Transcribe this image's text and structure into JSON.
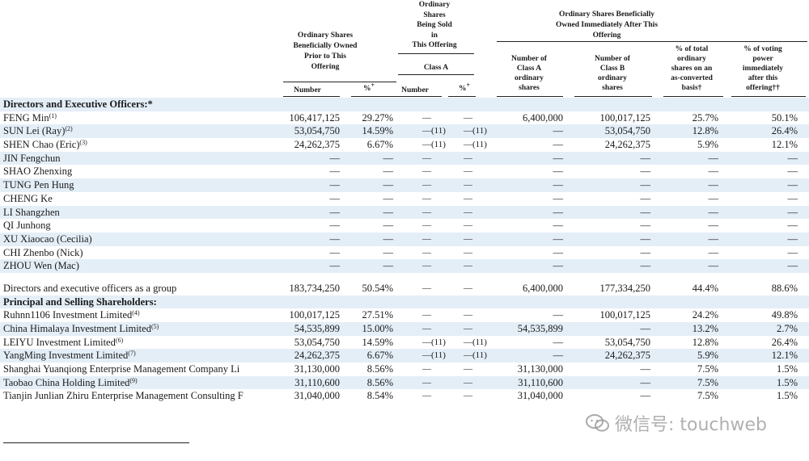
{
  "headers": {
    "group_prior": [
      "Ordinary Shares",
      "Beneficially Owned",
      "Prior to This",
      "Offering"
    ],
    "group_sold": [
      "Ordinary",
      "Shares",
      "Being Sold",
      "in",
      "This Offering"
    ],
    "group_after": [
      "Ordinary Shares Beneficially",
      "Owned Immediately After This",
      "Offering"
    ],
    "class_a": "Class A",
    "sub_number": "Number",
    "sub_pct": "%",
    "sub_pct_mark": "+",
    "sub_sold_number": "Number",
    "sub_sold_pct": "%",
    "sub_num_class_a": [
      "Number of",
      "Class A",
      "ordinary",
      "shares"
    ],
    "sub_num_class_b": [
      "Number of",
      "Class B",
      "ordinary",
      "shares"
    ],
    "sub_pct_total": [
      "% of total",
      "ordinary",
      "shares on an",
      "as-converted",
      "basis†"
    ],
    "sub_pct_voting": [
      "% of voting",
      "power",
      "immediately",
      "after this",
      "offering††"
    ]
  },
  "rows": [
    {
      "type": "section",
      "name": "Directors and Executive Officers:*"
    },
    {
      "name": "FENG Min",
      "note": "(1)",
      "num": "106,417,125",
      "pct": "29.27%",
      "sold_num": "—",
      "sold_pct": "—",
      "class_a": "6,400,000",
      "class_b": "100,017,125",
      "pct_total": "25.7%",
      "pct_voting": "50.1%"
    },
    {
      "name": "SUN Lei (Ray)",
      "note": "(2)",
      "num": "53,054,750",
      "pct": "14.59%",
      "sold_num": "—(11)",
      "sold_pct": "—(11)",
      "class_a": "—",
      "class_b": "53,054,750",
      "pct_total": "12.8%",
      "pct_voting": "26.4%"
    },
    {
      "name": "SHEN Chao (Eric)",
      "note": "(3)",
      "num": "24,262,375",
      "pct": "6.67%",
      "sold_num": "—(11)",
      "sold_pct": "—(11)",
      "class_a": "—",
      "class_b": "24,262,375",
      "pct_total": "5.9%",
      "pct_voting": "12.1%"
    },
    {
      "name": "JIN Fengchun",
      "note": "",
      "num": "—",
      "pct": "—",
      "sold_num": "—",
      "sold_pct": "—",
      "class_a": "—",
      "class_b": "—",
      "pct_total": "—",
      "pct_voting": "—"
    },
    {
      "name": "SHAO Zhenxing",
      "note": "",
      "num": "—",
      "pct": "—",
      "sold_num": "—",
      "sold_pct": "—",
      "class_a": "—",
      "class_b": "—",
      "pct_total": "—",
      "pct_voting": "—"
    },
    {
      "name": "TUNG Pen Hung",
      "note": "",
      "num": "—",
      "pct": "—",
      "sold_num": "—",
      "sold_pct": "—",
      "class_a": "—",
      "class_b": "—",
      "pct_total": "—",
      "pct_voting": "—"
    },
    {
      "name": "CHENG Ke",
      "note": "",
      "num": "—",
      "pct": "—",
      "sold_num": "—",
      "sold_pct": "—",
      "class_a": "—",
      "class_b": "—",
      "pct_total": "—",
      "pct_voting": "—"
    },
    {
      "name": "LI Shangzhen",
      "note": "",
      "num": "—",
      "pct": "—",
      "sold_num": "—",
      "sold_pct": "—",
      "class_a": "—",
      "class_b": "—",
      "pct_total": "—",
      "pct_voting": "—"
    },
    {
      "name": "QI Junhong",
      "note": "",
      "num": "—",
      "pct": "—",
      "sold_num": "—",
      "sold_pct": "—",
      "class_a": "—",
      "class_b": "—",
      "pct_total": "—",
      "pct_voting": "—"
    },
    {
      "name": "XU Xiaocao (Cecilia)",
      "note": "",
      "num": "—",
      "pct": "—",
      "sold_num": "—",
      "sold_pct": "—",
      "class_a": "—",
      "class_b": "—",
      "pct_total": "—",
      "pct_voting": "—"
    },
    {
      "name": "CHI Zhenbo (Nick)",
      "note": "",
      "num": "—",
      "pct": "—",
      "sold_num": "—",
      "sold_pct": "—",
      "class_a": "—",
      "class_b": "—",
      "pct_total": "—",
      "pct_voting": "—"
    },
    {
      "name": "ZHOU Wen (Mac)",
      "note": "",
      "num": "—",
      "pct": "—",
      "sold_num": "—",
      "sold_pct": "—",
      "class_a": "—",
      "class_b": "—",
      "pct_total": "—",
      "pct_voting": "—"
    },
    {
      "type": "spacer"
    },
    {
      "name": "Directors and executive officers as a group",
      "note": "",
      "num": "183,734,250",
      "pct": "50.54%",
      "sold_num": "—",
      "sold_pct": "—",
      "class_a": "6,400,000",
      "class_b": "177,334,250",
      "pct_total": "44.4%",
      "pct_voting": "88.6%"
    },
    {
      "type": "section",
      "name": "Principal and Selling Shareholders:"
    },
    {
      "name": "Ruhnn1106 Investment Limited",
      "note": "(4)",
      "num": "100,017,125",
      "pct": "27.51%",
      "sold_num": "—",
      "sold_pct": "—",
      "class_a": "—",
      "class_b": "100,017,125",
      "pct_total": "24.2%",
      "pct_voting": "49.8%"
    },
    {
      "name": "China Himalaya Investment Limited",
      "note": "(5)",
      "num": "54,535,899",
      "pct": "15.00%",
      "sold_num": "—",
      "sold_pct": "—",
      "class_a": "54,535,899",
      "class_b": "—",
      "pct_total": "13.2%",
      "pct_voting": "2.7%"
    },
    {
      "name": "LEIYU Investment Limited",
      "note": "(6)",
      "num": "53,054,750",
      "pct": "14.59%",
      "sold_num": "—(11)",
      "sold_pct": "—(11)",
      "class_a": "—",
      "class_b": "53,054,750",
      "pct_total": "12.8%",
      "pct_voting": "26.4%"
    },
    {
      "name": "YangMing Investment Limited",
      "note": "(7)",
      "num": "24,262,375",
      "pct": "6.67%",
      "sold_num": "—(11)",
      "sold_pct": "—(11)",
      "class_a": "—",
      "class_b": "24,262,375",
      "pct_total": "5.9%",
      "pct_voting": "12.1%"
    },
    {
      "name": "Shanghai Yuanqiong Enterprise Management Company Li",
      "note": "",
      "num": "31,130,000",
      "pct": "8.56%",
      "sold_num": "—",
      "sold_pct": "—",
      "class_a": "31,130,000",
      "class_b": "—",
      "pct_total": "7.5%",
      "pct_voting": "1.5%"
    },
    {
      "name": "Taobao China Holding Limited",
      "note": "(9)",
      "num": "31,110,600",
      "pct": "8.56%",
      "sold_num": "—",
      "sold_pct": "—",
      "class_a": "31,110,600",
      "class_b": "—",
      "pct_total": "7.5%",
      "pct_voting": "1.5%"
    },
    {
      "name": "Tianjin Junlian Zhiru Enterprise Management Consulting F",
      "note": "",
      "num": "31,040,000",
      "pct": "8.54%",
      "sold_num": "—",
      "sold_pct": "—",
      "class_a": "31,040,000",
      "class_b": "—",
      "pct_total": "7.5%",
      "pct_voting": "1.5%"
    }
  ],
  "watermark": "微信号: touchweb"
}
